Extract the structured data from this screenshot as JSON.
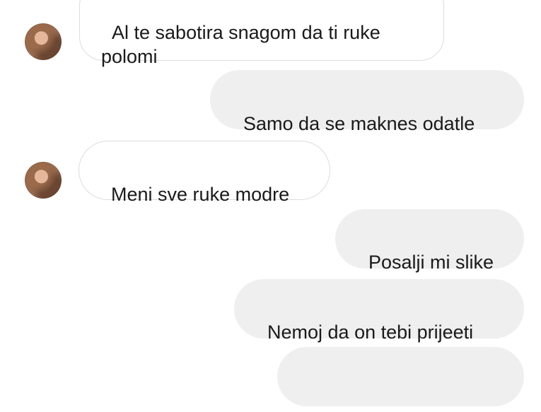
{
  "messages": [
    {
      "side": "in",
      "text": "Al te sabotira snagom da ti ruke\npolomi"
    },
    {
      "side": "out",
      "text": "Samo da se maknes odatle"
    },
    {
      "side": "in",
      "text": "Meni sve ruke modre"
    },
    {
      "side": "out",
      "text": "Posalji mi slike"
    },
    {
      "side": "out",
      "text": "Nemoj da on tebi prijeeti"
    },
    {
      "side": "out",
      "text": ""
    }
  ],
  "avatar": {
    "icon": "contact-avatar-photo"
  }
}
